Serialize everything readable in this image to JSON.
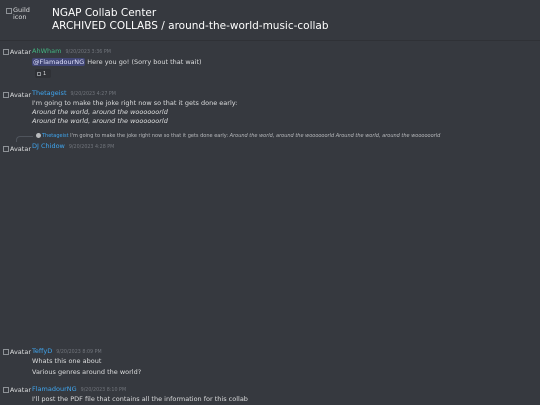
{
  "header": {
    "guild_icon_alt": "Guild icon",
    "guild_name": "NGAP Collab Center",
    "channel_path": "ARCHIVED COLLABS / around-the-world-music-collab"
  },
  "avatar_alt": "Avatar",
  "colors": {
    "background": "#36393f",
    "text": "#dcddde",
    "timestamp": "#72767d",
    "author_green": "#43b581",
    "author_blue": "#3fa6f0",
    "mention_bg": "#414675"
  },
  "messages": [
    {
      "author": "AhWham",
      "timestamp": "9/20/2023 3:36 PM",
      "mention": "@FlamadourNG",
      "text": " Here you go! (Sorry bout that wait)",
      "attachment_count": "1"
    },
    {
      "author": "Thetageist",
      "timestamp": "9/20/2023 4:27 PM",
      "lines": [
        "I'm going to make the joke right now so that it gets done early:",
        "Around the world, around the woooooorld",
        "Around the world, around the woooooorld"
      ]
    },
    {
      "reply": {
        "author": "Thetageist",
        "text": "I'm going to make the joke right now so that it gets done early: ",
        "italic_text": "Around the world, around the woooooorld Around the world, around the woooooorld"
      },
      "author": "DJ Chidow",
      "timestamp": "9/20/2023 4:28 PM"
    },
    {
      "author": "TeffyD",
      "timestamp": "9/20/2023 8:09 PM",
      "lines": [
        "Whats this one about",
        "Various genres around the world?"
      ]
    },
    {
      "author": "FlamadourNG",
      "timestamp": "9/20/2023 8:10 PM",
      "lines": [
        "I'll post the PDF file that contains all the information for this collab"
      ]
    }
  ]
}
